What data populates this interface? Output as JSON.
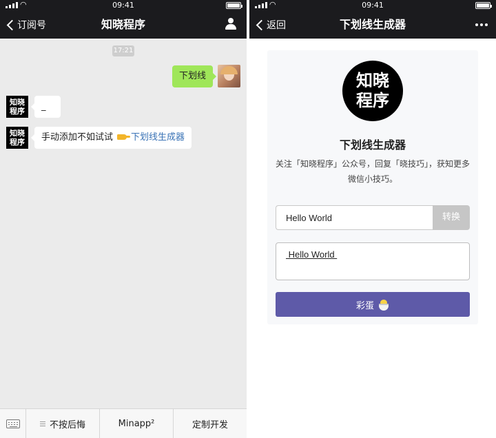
{
  "left": {
    "status": {
      "time": "09:41"
    },
    "nav": {
      "back_label": "订阅号",
      "title": "知晓程序"
    },
    "chat": {
      "timestamp": "17:21",
      "user_message": "下划线",
      "bot_avatar_line1": "知晓",
      "bot_avatar_line2": "程序",
      "bot_reply_1": "_",
      "bot_reply_2_text": "手动添加不如试试",
      "bot_reply_2_link": "下划线生成器"
    },
    "menu": {
      "item1": "不按后悔",
      "item2": "Minapp²",
      "item3": "定制开发"
    }
  },
  "right": {
    "status": {
      "time": "09:41"
    },
    "nav": {
      "back_label": "返回",
      "title": "下划线生成器"
    },
    "logo_line1": "知晓",
    "logo_line2": "程序",
    "title": "下划线生成器",
    "description": "关注「知晓程序」公众号，回复「晓技巧」，获知更多微信小技巧。",
    "input_value": "Hello World",
    "convert_label": "转换",
    "output_text": " Hello World ",
    "egg_label": "彩蛋"
  },
  "colors": {
    "nav_bg": "#1b1b1e",
    "chat_bg": "#ebebeb",
    "user_bubble": "#9fe659",
    "link": "#3a73b6",
    "egg_button": "#5e5aa8",
    "convert_button": "#c6c6c6"
  },
  "icons": [
    "signal-icon",
    "wifi-icon",
    "battery-icon",
    "chevron-left-icon",
    "person-icon",
    "more-dots-icon",
    "keyboard-icon",
    "menu-lines-icon",
    "pointing-hand-icon",
    "chick-icon"
  ]
}
